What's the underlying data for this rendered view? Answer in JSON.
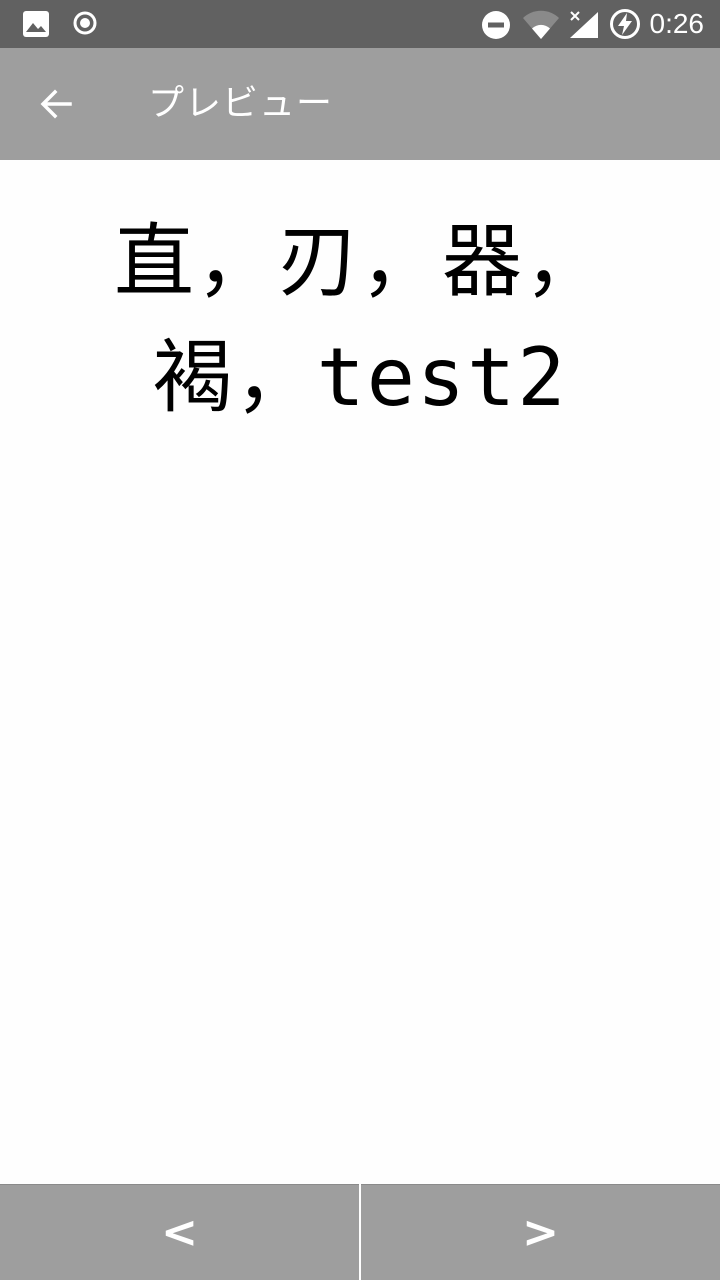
{
  "status_bar": {
    "time": "0:26",
    "icons": [
      "image-icon",
      "sync-circle-icon",
      "do-not-disturb-icon",
      "wifi-icon",
      "signal-no-data-icon",
      "battery-charging-icon"
    ]
  },
  "app_bar": {
    "back_icon": "arrow-back-icon",
    "title": "プレビュー"
  },
  "content": {
    "preview_text": "直，刃，器，褐，test2"
  },
  "bottom_bar": {
    "prev_label": "<",
    "next_label": ">"
  },
  "colors": {
    "status_bar": "#616161",
    "app_bar": "#9e9e9e",
    "bottom_bar": "#9e9e9e",
    "background": "#fefefe",
    "text": "#000000"
  }
}
